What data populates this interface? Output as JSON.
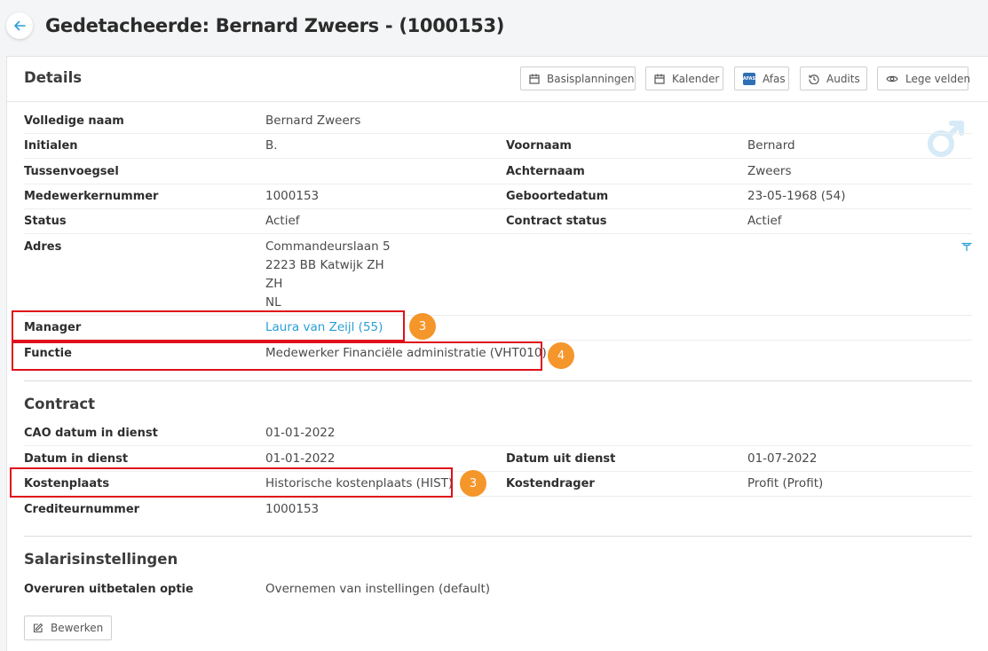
{
  "header": {
    "title": "Gedetacheerde: Bernard Zweers - (1000153)"
  },
  "details": {
    "title": "Details",
    "buttons": {
      "basisplanningen": "Basisplanningen",
      "kalender": "Kalender",
      "afas": "Afas",
      "afas_icon_text": "AFAS",
      "audits": "Audits",
      "lege_velden": "Lege velden"
    },
    "fields": {
      "volledige_naam": {
        "label": "Volledige naam",
        "value": "Bernard Zweers"
      },
      "initialen": {
        "label": "Initialen",
        "value": "B."
      },
      "voornaam": {
        "label": "Voornaam",
        "value": "Bernard"
      },
      "tussenvoegsel": {
        "label": "Tussenvoegsel",
        "value": ""
      },
      "achternaam": {
        "label": "Achternaam",
        "value": "Zweers"
      },
      "medewerkernummer": {
        "label": "Medewerkernummer",
        "value": "1000153"
      },
      "geboortedatum": {
        "label": "Geboortedatum",
        "value": "23-05-1968 (54)"
      },
      "status": {
        "label": "Status",
        "value": "Actief"
      },
      "contract_status": {
        "label": "Contract status",
        "value": "Actief"
      },
      "adres": {
        "label": "Adres",
        "lines": [
          "Commandeurslaan 5",
          "2223 BB Katwijk ZH",
          "ZH",
          "NL"
        ]
      },
      "manager": {
        "label": "Manager",
        "value": "Laura van Zeijl (55)"
      },
      "functie": {
        "label": "Functie",
        "value": "Medewerker Financiële administratie (VHT010)"
      }
    }
  },
  "contract": {
    "title": "Contract",
    "fields": {
      "cao_datum": {
        "label": "CAO datum in dienst",
        "value": "01-01-2022"
      },
      "datum_in_dienst": {
        "label": "Datum in dienst",
        "value": "01-01-2022"
      },
      "datum_uit_dienst": {
        "label": "Datum uit dienst",
        "value": "01-07-2022"
      },
      "kostenplaats": {
        "label": "Kostenplaats",
        "value": "Historische kostenplaats (HIST)"
      },
      "kostendrager": {
        "label": "Kostendrager",
        "value": "Profit (Profit)"
      },
      "crediteurnummer": {
        "label": "Crediteurnummer",
        "value": "1000153"
      }
    }
  },
  "salaris": {
    "title": "Salarisinstellingen",
    "fields": {
      "overuren": {
        "label": "Overuren uitbetalen optie",
        "value": "Overnemen van instellingen (default)"
      }
    }
  },
  "actions": {
    "edit_label": "Bewerken"
  },
  "annotations": {
    "badge_manager": "3",
    "badge_functie": "4",
    "badge_kostenplaats": "3"
  },
  "colors": {
    "accent": "#2a9fd6",
    "highlight": "#e0101a",
    "badge": "#f5962b"
  },
  "icons": [
    "arrow-left-icon",
    "calendar-icon",
    "afas-logo-icon",
    "history-icon",
    "eye-icon",
    "male-gender-icon",
    "map-pin-icon",
    "edit-icon"
  ]
}
